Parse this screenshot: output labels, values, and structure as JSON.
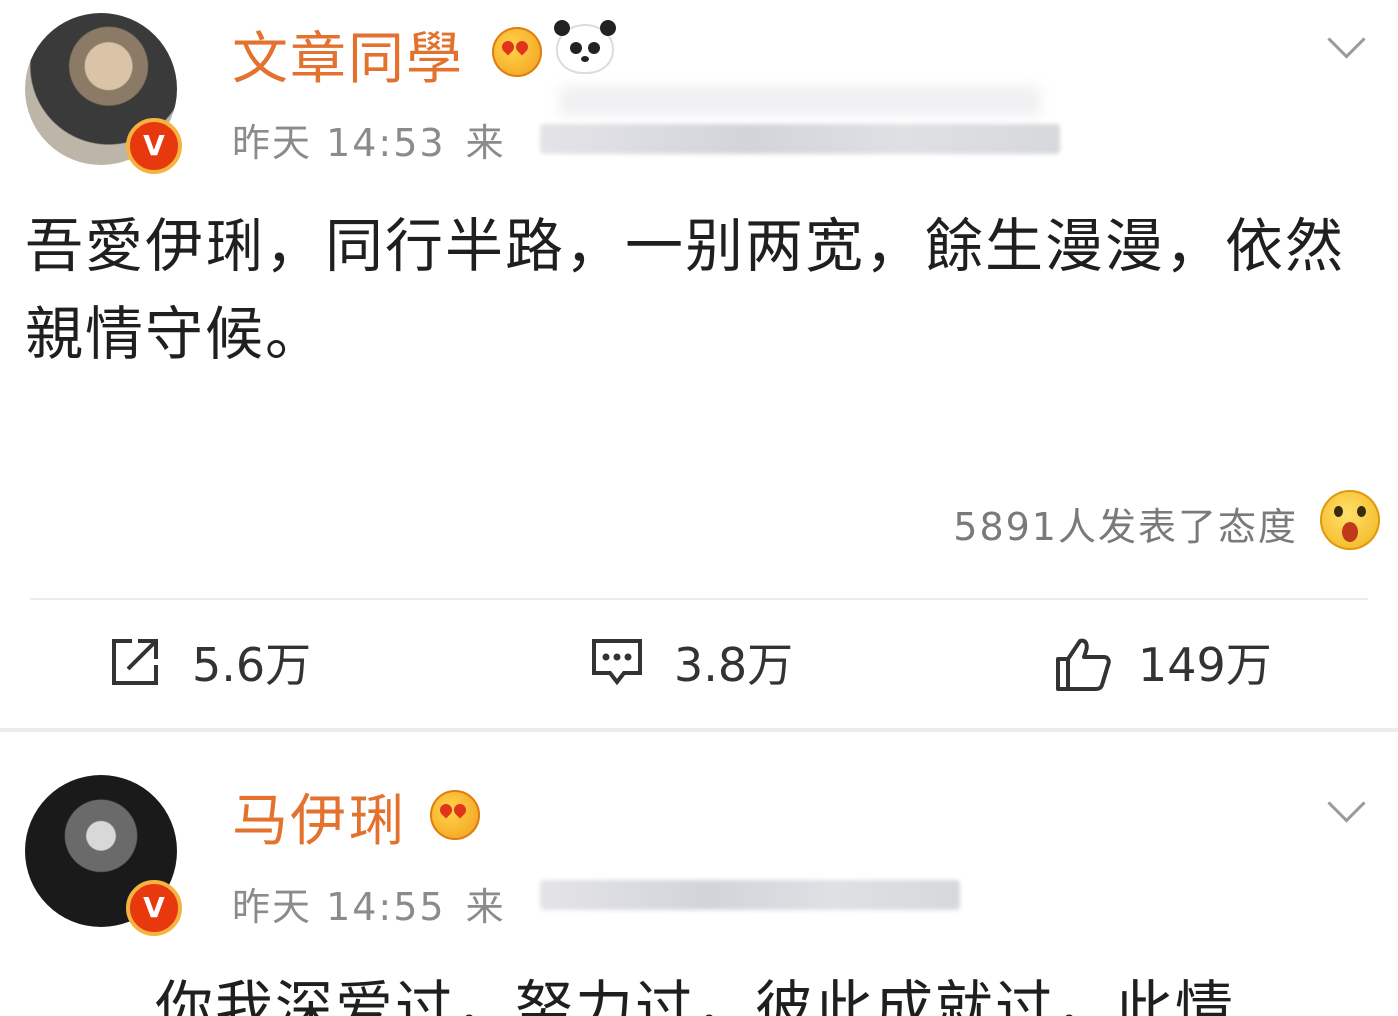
{
  "posts": [
    {
      "username": "文章同學",
      "time": "昨天 14:53",
      "source_prefix": "来",
      "content": "吾愛伊琍，同行半路，一别两宽，餘生漫漫，依然親情守候。",
      "reactions_text": "5891人发表了态度",
      "repost_count": "5.6万",
      "comment_count": "3.8万",
      "like_count": "149万",
      "verified_badge": "V"
    },
    {
      "username": "马伊琍",
      "time": "昨天 14:55",
      "source_prefix": "来",
      "content": "你我深爱过，努力过，彼此成就过，此情",
      "verified_badge": "V"
    }
  ],
  "icons": {
    "repost": "share-arrow-icon",
    "comment": "comment-bubble-icon",
    "like": "thumbs-up-icon",
    "more": "chevron-down-icon"
  },
  "colors": {
    "username": "#e3722f",
    "meta": "#8b8b8b",
    "verified": "#e8380d"
  }
}
